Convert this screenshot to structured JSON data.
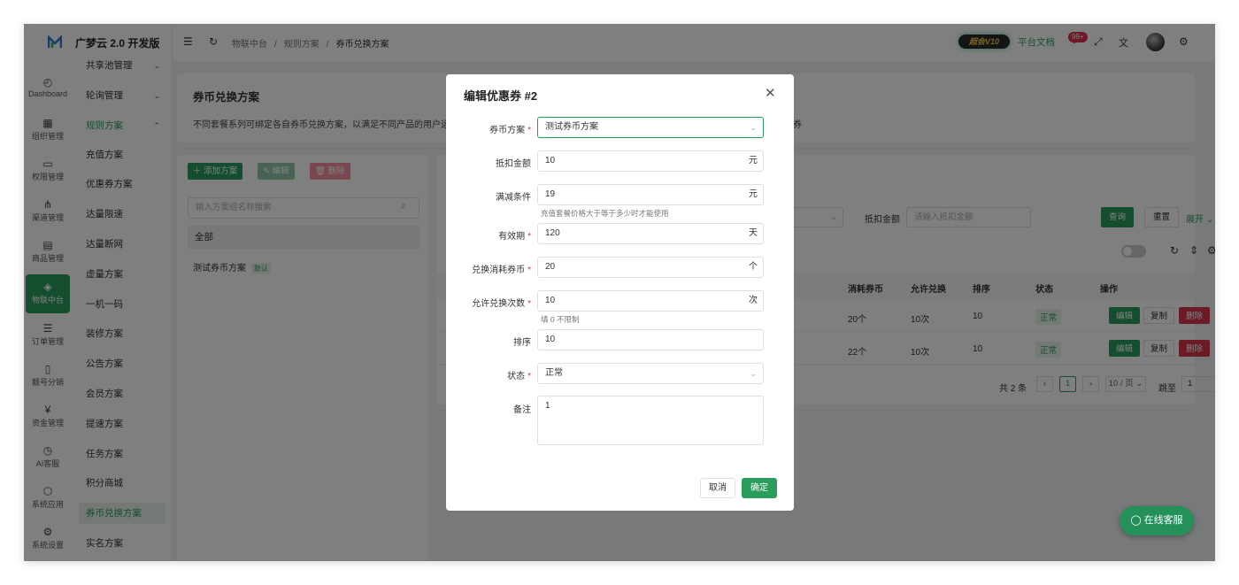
{
  "app": {
    "brand": "广梦云 2.0 开发版"
  },
  "rail": [
    {
      "label": "Dashboard",
      "icon": "dashboard-icon",
      "glyph": "◴"
    },
    {
      "label": "组织管理",
      "icon": "grid-icon",
      "glyph": "▦"
    },
    {
      "label": "权限管理",
      "icon": "monitor-icon",
      "glyph": "▭"
    },
    {
      "label": "渠道管理",
      "icon": "network-icon",
      "glyph": "⋔"
    },
    {
      "label": "商品管理",
      "icon": "store-icon",
      "glyph": "▤"
    },
    {
      "label": "物联中台",
      "icon": "iot-icon",
      "glyph": "◈"
    },
    {
      "label": "订单管理",
      "icon": "list-icon",
      "glyph": "☰"
    },
    {
      "label": "靓号分销",
      "icon": "phone-icon",
      "glyph": "▯"
    },
    {
      "label": "资金管理",
      "icon": "money-icon",
      "glyph": "¥"
    },
    {
      "label": "AI客服",
      "icon": "ai-icon",
      "glyph": "◷"
    },
    {
      "label": "系统应用",
      "icon": "cube-icon",
      "glyph": "⬡"
    },
    {
      "label": "系统设置",
      "icon": "gear-icon",
      "glyph": "⚙"
    }
  ],
  "submenu": [
    {
      "label": "共享池管理",
      "chev": "⌄"
    },
    {
      "label": "轮询管理",
      "chev": "⌄"
    },
    {
      "label": "规则方案",
      "chev": "⌃"
    },
    {
      "label": "充值方案"
    },
    {
      "label": "优惠券方案"
    },
    {
      "label": "达量限速"
    },
    {
      "label": "达量断网"
    },
    {
      "label": "虚量方案"
    },
    {
      "label": "一机一码"
    },
    {
      "label": "装修方案"
    },
    {
      "label": "公告方案"
    },
    {
      "label": "会员方案"
    },
    {
      "label": "提速方案"
    },
    {
      "label": "任务方案"
    },
    {
      "label": "积分商城"
    },
    {
      "label": "券币兑换方案"
    },
    {
      "label": "实名方案"
    }
  ],
  "header": {
    "breadcrumb": [
      "物联中台",
      "规则方案",
      "券币兑换方案"
    ],
    "sep": "/",
    "vip": "超会V10",
    "doc_link": "平台文档",
    "badge": "99+"
  },
  "page": {
    "title": "券币兑换方案",
    "desc": "不同套餐系列可绑定各自券币兑换方案，以满足不同产品的用户运",
    "desc_tail": "券"
  },
  "left": {
    "add": "＋ 添加方案",
    "edit": "✎ 编辑",
    "del": "🗑 删除",
    "search_placeholder": "输入方案组名称搜索",
    "all": "全部",
    "plan_name": "测试券币方案",
    "plan_tag": "默认"
  },
  "right": {
    "filter_label": "抵扣金额",
    "filter_placeholder": "请输入抵扣金额",
    "query": "查询",
    "reset": "重置",
    "expand": "展开 ⌄",
    "columns": [
      "消耗券币",
      "允许兑换",
      "排序",
      "状态",
      "操作"
    ],
    "rows": [
      {
        "coins": "20个",
        "times": "10次",
        "sort": "10",
        "status": "正常"
      },
      {
        "coins": "22个",
        "times": "10次",
        "sort": "10",
        "status": "正常"
      }
    ],
    "actions": {
      "edit": "编辑",
      "copy": "复制",
      "delete": "删除"
    },
    "total": "共 2 条",
    "page": "1",
    "size": "10 / 页 ⌄",
    "jump": "跳至",
    "jump_value": "1"
  },
  "modal": {
    "title": "编辑优惠券 #2",
    "fields": {
      "plan": {
        "label": "券币方案",
        "value": "测试券币方案"
      },
      "amount": {
        "label": "抵扣金额",
        "value": "10",
        "suffix": "元"
      },
      "threshold": {
        "label": "满减条件",
        "value": "19",
        "suffix": "元",
        "help": "充值套餐价格大于等于多少时才能使用"
      },
      "validity": {
        "label": "有效期",
        "value": "120",
        "suffix": "天"
      },
      "coins": {
        "label": "兑换消耗券币",
        "value": "20",
        "suffix": "个"
      },
      "times": {
        "label": "允许兑换次数",
        "value": "10",
        "suffix": "次",
        "help": "填 0 不限制"
      },
      "sort": {
        "label": "排序",
        "value": "10"
      },
      "status": {
        "label": "状态",
        "value": "正常"
      },
      "remark": {
        "label": "备注",
        "value": "1"
      }
    },
    "cancel": "取消",
    "ok": "确定"
  },
  "chat": "◯ 在线客服",
  "colors": {
    "primary": "#2a9d5c",
    "danger": "#e0314b"
  }
}
